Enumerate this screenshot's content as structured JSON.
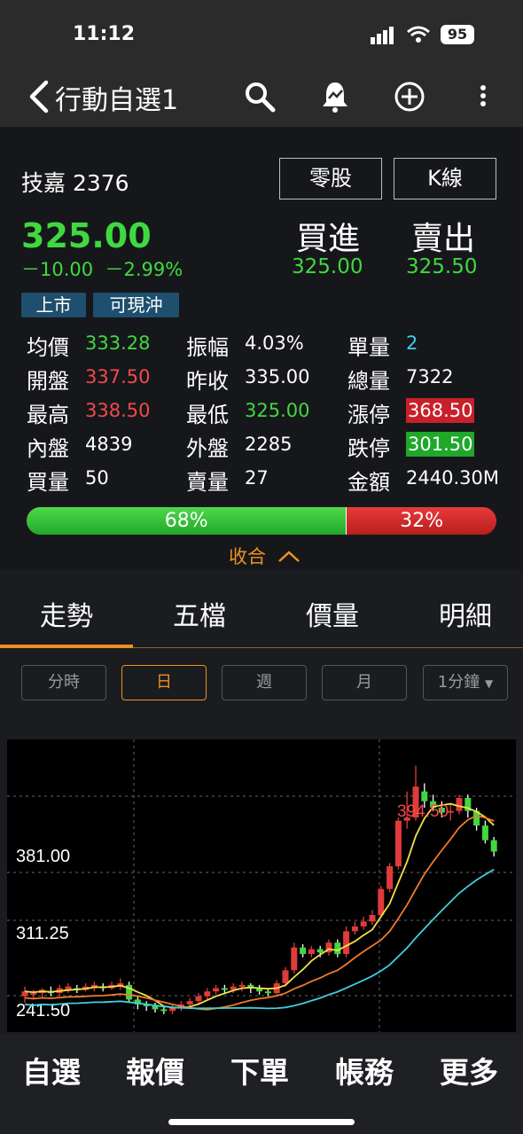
{
  "status_bar": {
    "time": "11:12",
    "battery": "95"
  },
  "nav": {
    "back_title": "行動自選1"
  },
  "stock": {
    "name": "技嘉",
    "code": "2376",
    "odd_lot_button": "零股",
    "kline_button": "K線",
    "price": "325.00",
    "change": "－10.00",
    "change_pct": "－2.99%",
    "buy_label": "買進",
    "sell_label": "賣出",
    "buy_price": "325.00",
    "sell_price": "325.50",
    "tags": [
      "上市",
      "可現沖"
    ]
  },
  "quotes": {
    "avg_label": "均價",
    "avg": "333.28",
    "amp_label": "振幅",
    "amp": "4.03%",
    "unit_vol_label": "單量",
    "unit_vol": "2",
    "open_label": "開盤",
    "open": "337.50",
    "prev_close_label": "昨收",
    "prev_close": "335.00",
    "total_vol_label": "總量",
    "total_vol": "7322",
    "high_label": "最高",
    "high": "338.50",
    "low_label": "最低",
    "low": "325.00",
    "limit_up_label": "漲停",
    "limit_up": "368.50",
    "inner_label": "內盤",
    "inner": "4839",
    "outer_label": "外盤",
    "outer": "2285",
    "limit_down_label": "跌停",
    "limit_down": "301.50",
    "bid_vol_label": "買量",
    "bid_vol": "50",
    "ask_vol_label": "賣量",
    "ask_vol": "27",
    "amount_label": "金額",
    "amount": "2440.30M"
  },
  "ratio": {
    "green_pct": 68,
    "green_label": "68%",
    "red_label": "32%"
  },
  "collapse_label": "收合",
  "tabs": [
    "走勢",
    "五檔",
    "價量",
    "明細"
  ],
  "periods": [
    "分時",
    "日",
    "週",
    "月",
    "1分鐘"
  ],
  "chart_data": {
    "type": "candlestick",
    "y_tick_labels": [
      "381.00",
      "311.25",
      "241.50"
    ],
    "high_label": "394.50",
    "ylim": [
      230,
      410
    ],
    "ma_colors": [
      "#f5e04a",
      "#f07a2a",
      "#3ecfe0"
    ]
  },
  "bottom_nav": [
    "自選",
    "報價",
    "下單",
    "帳務",
    "更多"
  ],
  "colors": {
    "up": "#e03a3a",
    "down": "#3fd93f",
    "accent": "#f0901e",
    "tag_bg": "#1f4f6e"
  }
}
